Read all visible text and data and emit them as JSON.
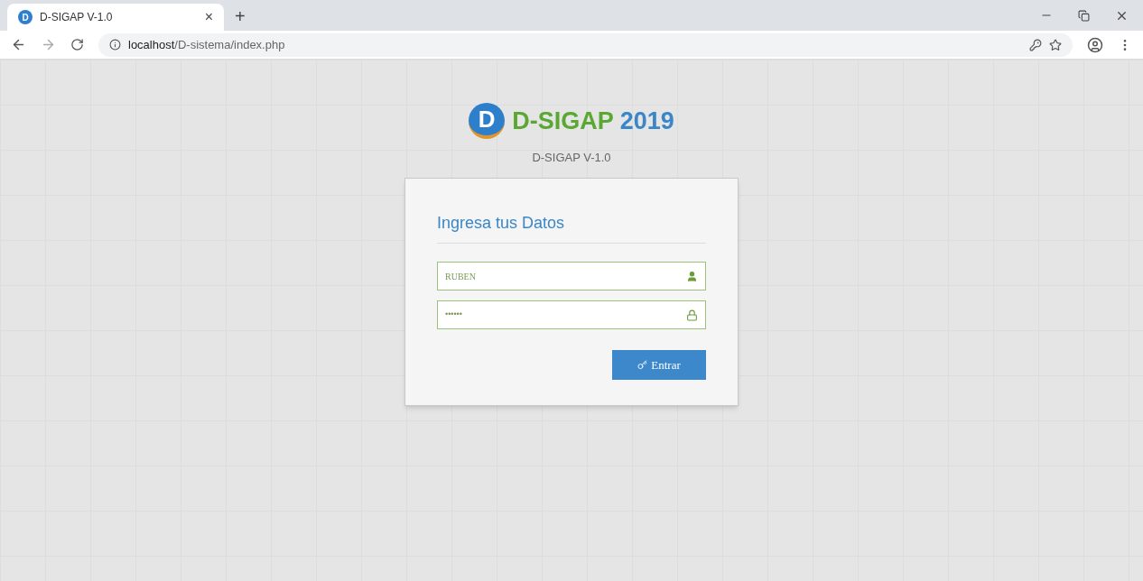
{
  "browser": {
    "tab": {
      "favicon_letter": "D",
      "title": "D-SIGAP V-1.0",
      "close": "×",
      "new_tab": "+"
    },
    "url_host": "localhost",
    "url_path": "/D-sistema/index.php"
  },
  "header": {
    "logo_letter": "D",
    "title_main": "D-SIGAP",
    "title_year": "2019",
    "subtitle": "D-SIGAP V-1.0"
  },
  "login": {
    "heading": "Ingresa tus Datos",
    "username": "RUBEN",
    "password": "••••••",
    "button": "Entrar"
  }
}
